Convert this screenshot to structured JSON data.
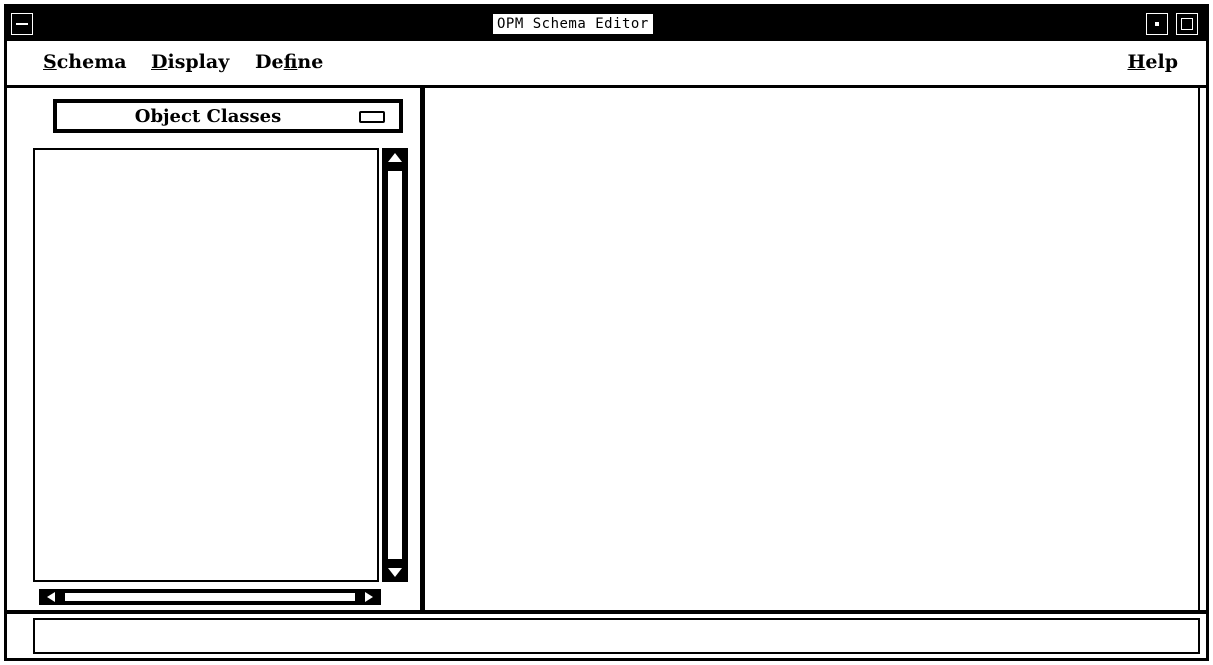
{
  "window": {
    "title": "OPM Schema Editor"
  },
  "menubar": {
    "items": [
      {
        "mnemonic": "S",
        "rest": "chema"
      },
      {
        "mnemonic": "D",
        "rest": "isplay"
      },
      {
        "pre": "De",
        "mnemonic": "f",
        "rest": "ine"
      },
      {
        "mnemonic": "H",
        "rest": "elp"
      }
    ]
  },
  "left_pane": {
    "header_label": "Object Classes",
    "list_items": []
  },
  "statusbar": {
    "text": ""
  },
  "icons": [
    "system-menu-icon",
    "minimize-icon",
    "maximize-icon",
    "toggle-indicator-icon",
    "arrow-up-icon",
    "arrow-down-icon",
    "arrow-left-icon",
    "arrow-right-icon"
  ]
}
